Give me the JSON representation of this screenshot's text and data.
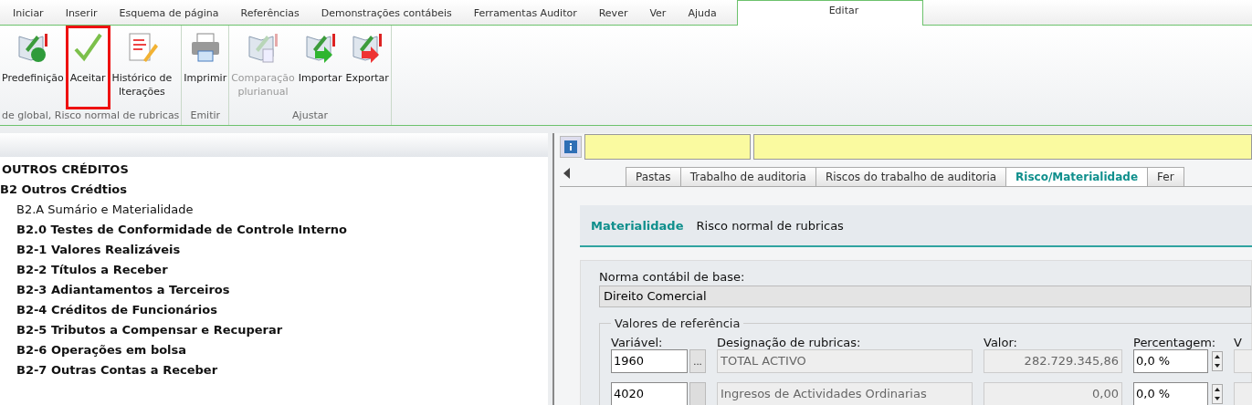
{
  "menu_tabs": [
    {
      "label": "Iniciar",
      "selected": false
    },
    {
      "label": "Inserir",
      "selected": false
    },
    {
      "label": "Esquema de página",
      "selected": false
    },
    {
      "label": "Referências",
      "selected": false
    },
    {
      "label": "Demonstrações contábeis",
      "selected": false
    },
    {
      "label": "Ferramentas Auditor",
      "selected": false
    },
    {
      "label": "Rever",
      "selected": false
    },
    {
      "label": "Ver",
      "selected": false
    },
    {
      "label": "Ajuda",
      "selected": false
    },
    {
      "label": "Editar",
      "selected": true
    }
  ],
  "ribbon_groups": [
    {
      "label": "de global, Risco normal de rubricas",
      "buttons": [
        {
          "kind": "preset",
          "lines": [
            "Predefinição"
          ],
          "disabled": false,
          "highlighted": false
        },
        {
          "kind": "accept",
          "lines": [
            "Aceitar"
          ],
          "disabled": false,
          "highlighted": true
        },
        {
          "kind": "history",
          "lines": [
            "Histórico de",
            "lterações"
          ],
          "disabled": false,
          "highlighted": false
        }
      ]
    },
    {
      "label": "Emitir",
      "buttons": [
        {
          "kind": "print",
          "lines": [
            "Imprimir"
          ],
          "disabled": false,
          "highlighted": false
        }
      ]
    },
    {
      "label": "Ajustar",
      "buttons": [
        {
          "kind": "compare",
          "lines": [
            "Comparação",
            "plurianual"
          ],
          "disabled": true,
          "highlighted": false
        },
        {
          "kind": "import",
          "lines": [
            "Importar"
          ],
          "disabled": false,
          "highlighted": false
        },
        {
          "kind": "export",
          "lines": [
            "Exportar"
          ],
          "disabled": false,
          "highlighted": false
        }
      ]
    }
  ],
  "tree": [
    {
      "label": "OUTROS CRÉDITOS",
      "kind": "section",
      "children": [
        {
          "label": "B2  Outros Crédtios",
          "kind": "section",
          "children": [
            {
              "label": "B2.A Sumário e Materialidade",
              "kind": "document"
            },
            {
              "label": "B2.0  Testes de Conformidade de Controle Interno",
              "kind": "section"
            },
            {
              "label": "B2-1 Valores Realizáveis",
              "kind": "section"
            },
            {
              "label": "B2-2 Títulos a Receber",
              "kind": "section"
            },
            {
              "label": "B2-3 Adiantamentos a Terceiros",
              "kind": "section"
            },
            {
              "label": "B2-4 Créditos de Funcionários",
              "kind": "section"
            },
            {
              "label": "B2-5 Tributos a Compensar e Recuperar",
              "kind": "section"
            },
            {
              "label": "B2-6 Operações em bolsa",
              "kind": "section"
            },
            {
              "label": "B2-7 Outras Contas a Receber",
              "kind": "section"
            }
          ]
        }
      ]
    }
  ],
  "doc_tabs": [
    {
      "label": "Pastas",
      "selected": false
    },
    {
      "label": "Trabalho de auditoria",
      "selected": false
    },
    {
      "label": "Riscos do trabalho de auditoria",
      "selected": false
    },
    {
      "label": "Risco/Materialidade",
      "selected": true
    },
    {
      "label": "Fer",
      "selected": false
    }
  ],
  "sub_tabs": [
    {
      "label": "Materialidade",
      "selected": true
    },
    {
      "label": "Risco normal de rubricas",
      "selected": false
    }
  ],
  "form": {
    "norma_label": "Norma contábil de base:",
    "norma_value": "Direito Comercial",
    "group_title": "Valores de referência",
    "columns": [
      "Variável:",
      "Designação de rubricas:",
      "Valor:",
      "Percentagem:",
      "V"
    ],
    "rows": [
      {
        "variable": "1960",
        "browse": "...",
        "designation": "TOTAL ACTIVO",
        "value": "282.729.345,86",
        "percentage": "0,0  %"
      },
      {
        "variable": "4020",
        "browse_disabled": true,
        "designation": "Ingresos de Actividades Ordinarias",
        "value": "0,00",
        "percentage": "0,0  %"
      }
    ]
  }
}
